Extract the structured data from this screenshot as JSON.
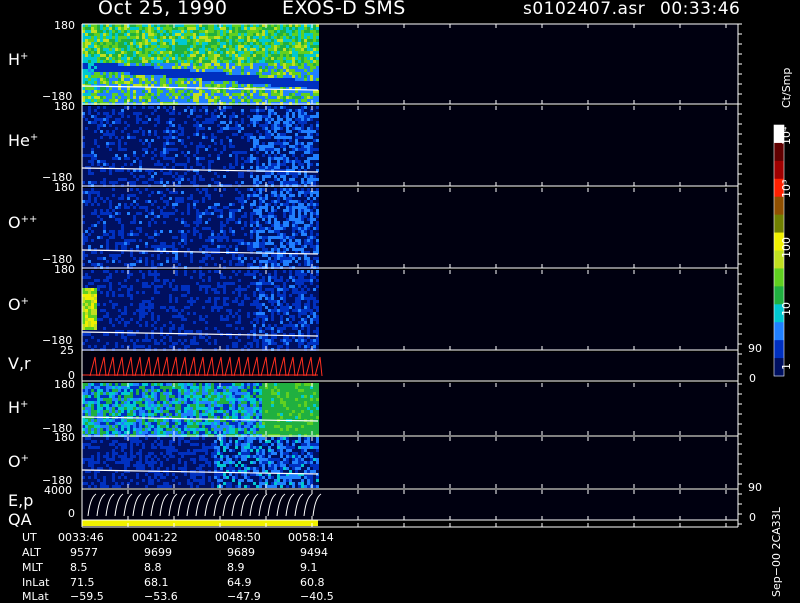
{
  "header": {
    "date": "Oct 25, 1990",
    "mission": "EXOS-D SMS",
    "file": "s0102407.asr",
    "time": "00:33:46"
  },
  "panels": [
    {
      "label": "H",
      "charge": "+",
      "ytop": "180",
      "ybot": "−180"
    },
    {
      "label": "He",
      "charge": "+",
      "ytop": "180",
      "ybot": "−180"
    },
    {
      "label": "O",
      "charge": "++",
      "ytop": "180",
      "ybot": "−180"
    },
    {
      "label": "O",
      "charge": "+",
      "ytop": "180",
      "ybot": "−180",
      "rtick": "90"
    },
    {
      "label": "V,r",
      "charge": "",
      "ytop": "25",
      "ybot": "0",
      "rtop": "90",
      "rbot": "0"
    },
    {
      "label": "H",
      "charge": "+",
      "ytop": "180",
      "ybot": "−180"
    },
    {
      "label": "O",
      "charge": "+",
      "ytop": "180",
      "ybot": "−180"
    },
    {
      "label": "E,p",
      "charge": "",
      "ytop": "4000",
      "ybot": "0",
      "rtop": "90",
      "rbot": "0"
    }
  ],
  "qa_label": "QA",
  "colorbar": {
    "unit": "Ct/Smp",
    "labels": [
      "10⁴",
      "10³",
      "100",
      "10",
      "1"
    ]
  },
  "footer": {
    "rows": [
      {
        "name": "UT",
        "values": [
          "0033:46",
          "0041:22",
          "0048:50",
          "0058:14"
        ]
      },
      {
        "name": "ALT",
        "values": [
          "9577",
          "9699",
          "9689",
          "9494"
        ]
      },
      {
        "name": "MLT",
        "values": [
          "8.5",
          "8.8",
          "8.9",
          "9.1"
        ]
      },
      {
        "name": "InLat",
        "values": [
          "71.5",
          "68.1",
          "64.9",
          "60.8"
        ]
      },
      {
        "name": "MLat",
        "values": [
          "−59.5",
          "−53.6",
          "−47.9",
          "−40.5"
        ]
      }
    ],
    "stamp": "Sep−00 2CA33L"
  },
  "chart_data": {
    "type": "heatmap",
    "x_ticks": [
      "0033:46",
      "0041:22",
      "0048:50",
      "0058:14"
    ],
    "panels": [
      "H+",
      "He+",
      "O++",
      "O+",
      "V,r",
      "H+",
      "O+",
      "E,p"
    ],
    "colorbar_scale": "log",
    "colorbar_range": [
      1,
      10000
    ],
    "colorbar_unit": "Ct/Smp",
    "colors": [
      "#001060",
      "#0030c0",
      "#2080ff",
      "#00c8d0",
      "#20b040",
      "#60d020",
      "#c0e020",
      "#f0f000",
      "#708000",
      "#905000",
      "#ff2000",
      "#a00000",
      "#600000",
      "#ffffff"
    ]
  }
}
